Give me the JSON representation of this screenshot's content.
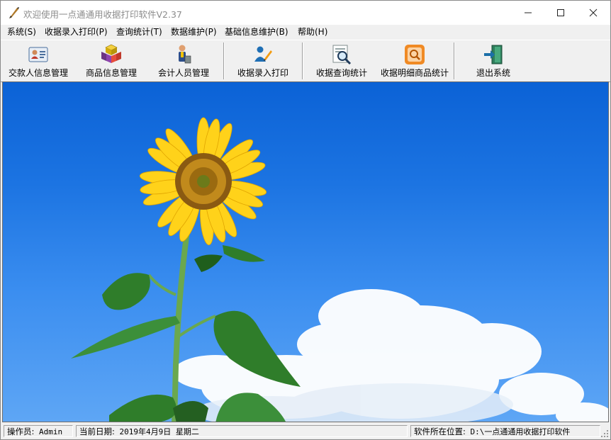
{
  "window": {
    "title": "欢迎使用一点通通用收据打印软件V2.37"
  },
  "menu": [
    {
      "label": "系统(S)"
    },
    {
      "label": "收据录入打印(P)"
    },
    {
      "label": "查询统计(T)"
    },
    {
      "label": "数据维护(P)"
    },
    {
      "label": "基础信息维护(B)"
    },
    {
      "label": "帮助(H)"
    }
  ],
  "toolbar": [
    {
      "label": "交款人信息管理",
      "icon": "payer-card-icon"
    },
    {
      "label": "商品信息管理",
      "icon": "product-boxes-icon"
    },
    {
      "label": "会计人员管理",
      "icon": "accountant-person-icon"
    },
    {
      "label": "收据录入打印",
      "icon": "receipt-entry-icon"
    },
    {
      "label": "收据查询统计",
      "icon": "receipt-query-icon"
    },
    {
      "label": "收据明细商品统计",
      "icon": "detail-search-icon"
    },
    {
      "label": "退出系统",
      "icon": "exit-door-icon"
    }
  ],
  "statusbar": {
    "operator_label": "操作员:",
    "operator": "Admin",
    "date_label": "当前日期:",
    "date": "2019年4月9日 星期二",
    "location_label": "软件所在位置:",
    "location": "D:\\一点通通用收据打印软件"
  },
  "colors": {
    "sky_top": "#0b62d6",
    "sky_bottom": "#5ea6f5",
    "petal": "#ffd21a",
    "leaf": "#2f7d2a"
  }
}
